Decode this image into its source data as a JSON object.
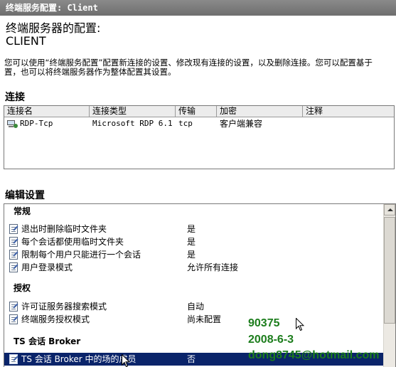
{
  "window": {
    "title": "终端服务配置: Client"
  },
  "header": {
    "heading": "终端服务器的配置:",
    "server_name": "CLIENT",
    "description_line1": "您可以使用“终端服务配置”配置新连接的设置、修改现有连接的设置，以及删除连接。您可以配置基于",
    "description_line2": "置，也可以将终端服务器作为整体配置其设置。"
  },
  "connections": {
    "section_title": "连接",
    "columns": [
      "连接名",
      "连接类型",
      "传输",
      "加密",
      "注释"
    ],
    "rows": [
      {
        "name": "RDP-Tcp",
        "type": "Microsoft RDP 6.1",
        "transport": "tcp",
        "encryption": "客户端兼容",
        "comment": "",
        "icon": "network-connection-icon"
      }
    ]
  },
  "edit_settings": {
    "section_title": "编辑设置",
    "groups": [
      {
        "title": "常规",
        "items": [
          {
            "label": "退出时删除临时文件夹",
            "value": "是"
          },
          {
            "label": "每个会话都使用临时文件夹",
            "value": "是"
          },
          {
            "label": "限制每个用户只能进行一个会话",
            "value": "是"
          },
          {
            "label": "用户登录模式",
            "value": "允许所有连接"
          }
        ]
      },
      {
        "title": "授权",
        "items": [
          {
            "label": "许可证服务器搜索模式",
            "value": "自动"
          },
          {
            "label": "终端服务授权模式",
            "value": "尚未配置"
          }
        ]
      },
      {
        "title": "TS 会话 Broker",
        "items": [
          {
            "label": "TS 会话 Broker 中的场的成员",
            "value": "否",
            "selected": true
          }
        ]
      }
    ],
    "item_icon": "property-document-icon"
  },
  "watermark": {
    "line1": "90375",
    "line2": "2008-6-3",
    "line3": "dong8745@hotmail.com",
    "color": "#1c7d1c"
  },
  "colors": {
    "titlebar": "#6e6e6e",
    "selection": "#0a246a"
  }
}
